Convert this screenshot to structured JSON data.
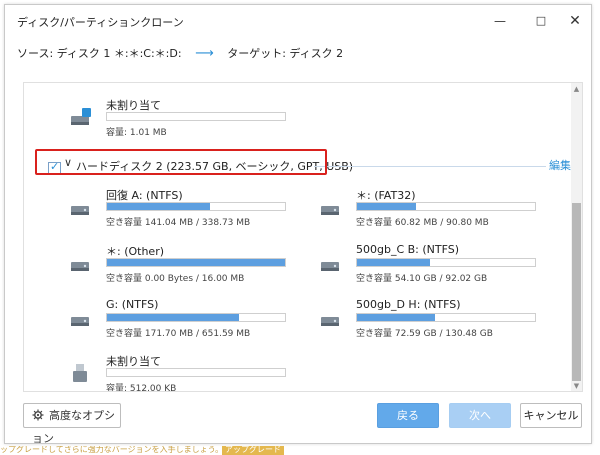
{
  "window": {
    "title": "ディスク/パーティションクローン",
    "minimize": "—",
    "maximize": "□",
    "close": "✕"
  },
  "route": {
    "source": "ソース:  ディスク 1 ＊:＊:C:＊:D:",
    "arrow": "⟶",
    "target": "ターゲット:  ディスク 2"
  },
  "top_part": {
    "name": "未割り当て",
    "stat": "容量: 1.01 MB",
    "fill": 0
  },
  "disk2": {
    "label": "ハードディスク 2 (223.57 GB, ベーシック, GPT, USB)",
    "checked": "✓",
    "chevron": "∨",
    "edit": "編集"
  },
  "partitions": [
    {
      "name": "回復 A: (NTFS)",
      "stat": "空き容量 141.04 MB / 338.73 MB",
      "fill": 0.58
    },
    {
      "name": "＊: (FAT32)",
      "stat": "空き容量 60.82 MB / 90.80 MB",
      "fill": 0.33
    },
    {
      "name": "＊: (Other)",
      "stat": "空き容量 0.00 Bytes / 16.00 MB",
      "fill": 1.0
    },
    {
      "name": "500gb_C B: (NTFS)",
      "stat": "空き容量 54.10 GB / 92.02 GB",
      "fill": 0.41
    },
    {
      "name": "G: (NTFS)",
      "stat": "空き容量 171.70 MB / 651.59 MB",
      "fill": 0.74
    },
    {
      "name": "500gb_D H: (NTFS)",
      "stat": "空き容量 72.59 GB / 130.48 GB",
      "fill": 0.44
    },
    {
      "name": "未割り当て",
      "stat": "容量: 512.00 KB",
      "fill": 0
    }
  ],
  "footer": {
    "advanced": "高度なオプション",
    "back": "戻る",
    "next": "次へ",
    "cancel": "キャンセル"
  },
  "promo": {
    "text": "ップグレードしてさらに強力なバージョンを入手しましょう。",
    "button": "アップグレード"
  },
  "colors": {
    "accent": "#2b8fd6",
    "bar": "#5d9fe0",
    "highlight": "#d9211d"
  }
}
